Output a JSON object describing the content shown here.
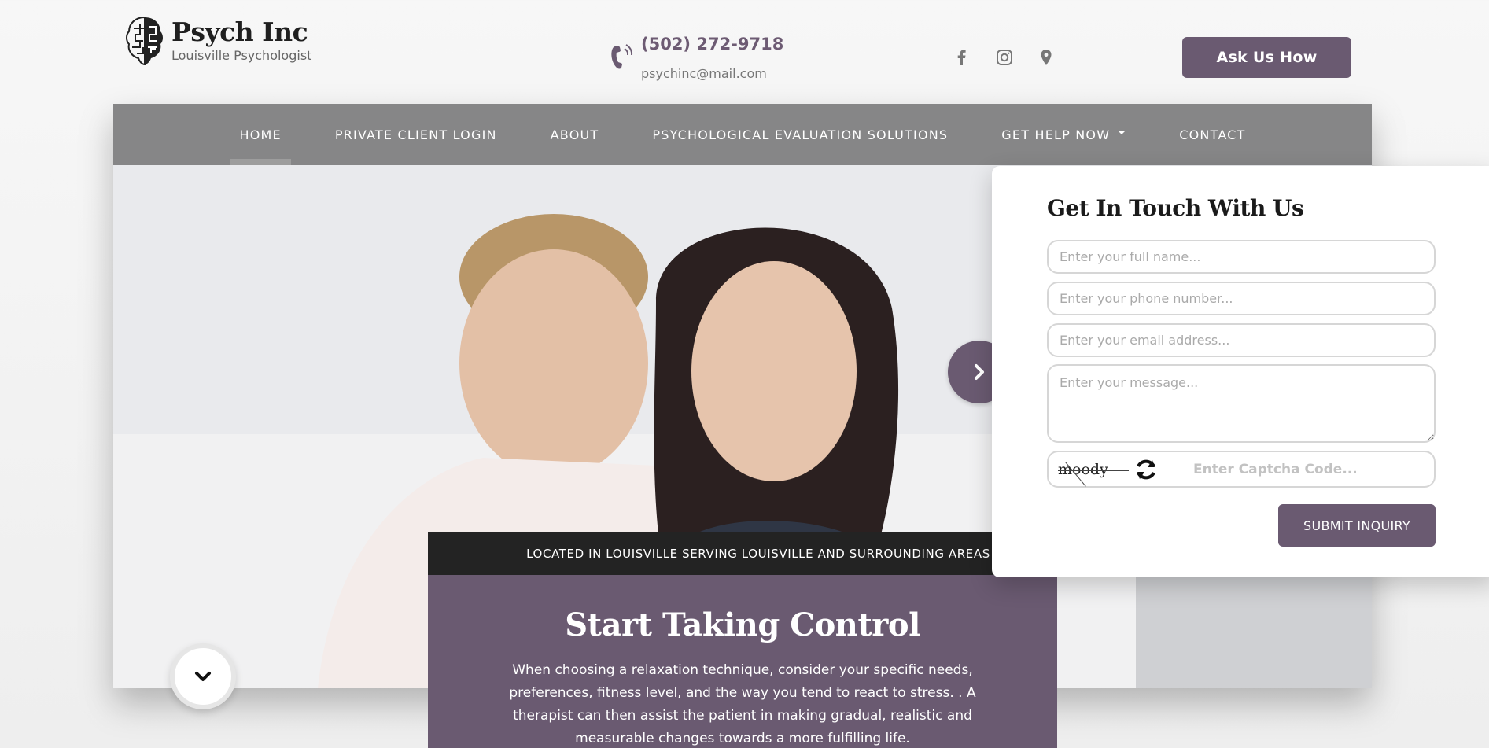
{
  "brand": {
    "name": "Psych Inc",
    "tagline": "Louisville Psychologist"
  },
  "contact": {
    "phone": "(502) 272-9718",
    "email": "psychinc@mail.com"
  },
  "header": {
    "cta_label": "Ask Us How",
    "social_icons": [
      "facebook-icon",
      "instagram-icon",
      "map-pin-icon"
    ]
  },
  "nav": {
    "items": [
      {
        "label": "HOME",
        "active": true
      },
      {
        "label": "PRIVATE CLIENT LOGIN"
      },
      {
        "label": "ABOUT"
      },
      {
        "label": "PSYCHOLOGICAL EVALUATION SOLUTIONS"
      },
      {
        "label": "GET HELP NOW",
        "dropdown": true
      },
      {
        "label": "CONTACT"
      }
    ]
  },
  "hero": {
    "location_text": "LOCATED IN LOUISVILLE SERVING LOUISVILLE AND SURROUNDING AREAS",
    "title": "Start Taking Control",
    "body": "When choosing a relaxation technique, consider your specific needs, preferences, fitness level, and the way you tend to react to stress. . A therapist can then assist the patient in making gradual, realistic and measurable changes towards a more fulfilling life."
  },
  "form": {
    "title": "Get In Touch With Us",
    "name_placeholder": "Enter your full name...",
    "phone_placeholder": "Enter your phone number...",
    "email_placeholder": "Enter your email address...",
    "message_placeholder": "Enter your message...",
    "captcha_word": "moody",
    "captcha_placeholder": "Enter Captcha Code...",
    "submit_label": "SUBMIT INQUIRY"
  },
  "colors": {
    "accent": "#6a5a71",
    "nav_bg": "#707070",
    "dark_bar": "#232323"
  }
}
